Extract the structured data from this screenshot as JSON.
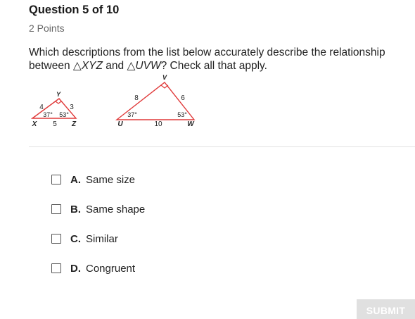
{
  "question": {
    "header": "Question 5 of 10",
    "points": "2 Points",
    "text_part1": "Which descriptions from the list below accurately describe the relationship between ",
    "triangle_symbol": "△",
    "triangle1_name": "XYZ",
    "text_and": " and ",
    "triangle2_name": "UVW",
    "text_part2": "? Check all that apply."
  },
  "figure": {
    "triangle_xyz": {
      "vertex_x": "X",
      "vertex_y": "Y",
      "vertex_z": "Z",
      "side_xy": "4",
      "side_yz": "3",
      "side_xz": "5",
      "angle_x": "37°",
      "angle_z": "53°"
    },
    "triangle_uvw": {
      "vertex_u": "U",
      "vertex_v": "V",
      "vertex_w": "W",
      "side_uv": "8",
      "side_vw": "6",
      "side_uw": "10",
      "angle_u": "37°",
      "angle_w": "53°"
    },
    "line_color": "#e03a3a"
  },
  "options": [
    {
      "letter": "A.",
      "text": "Same size"
    },
    {
      "letter": "B.",
      "text": "Same shape"
    },
    {
      "letter": "C.",
      "text": "Similar"
    },
    {
      "letter": "D.",
      "text": "Congruent"
    }
  ],
  "submit_label": "SUBMIT"
}
